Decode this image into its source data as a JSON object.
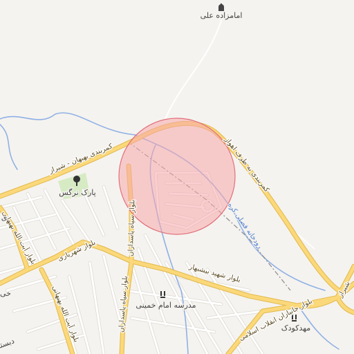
{
  "map": {
    "colors": {
      "background": "#f5f3ef",
      "major_road": "#fbd87a",
      "major_road_edge": "#e0b84a",
      "local_road": "#ffffff",
      "water": "#8fb0e6",
      "park": "#d6ebc4",
      "highlight_fill": "#f7a8ac",
      "highlight_stroke": "#e0707a"
    },
    "labels": {
      "imamzadeh": "امامزاده علی",
      "park": "پارک نرگس",
      "kamarbandi_west": "کمربندی بهبهان - شیراز",
      "kamarbandi_east": "کمربندی به طرف اهواز",
      "river": "رودخانه فصلی کره",
      "sepah": "بلوار سپاه پاسداران",
      "shahryari": "بلوار شهریاری",
      "behbahani": "بلوار آیت الله بهبهانی",
      "bishebahar": "بلوار شهید بیشبهار",
      "janbazan": "بلوار جانبازان انقلاب اسلامی",
      "school": "مدرسه امام خمینی",
      "kindergarten": "مهدکودک",
      "shiraz_edge": "شیراز",
      "left_edge_1": "ی",
      "left_edge_2": "خی",
      "left_edge_3": "دبستا"
    },
    "icons": {
      "mosque": "mosque-icon",
      "park": "tree-icon",
      "school": "school-icon",
      "kindergarten": "school-icon"
    }
  }
}
